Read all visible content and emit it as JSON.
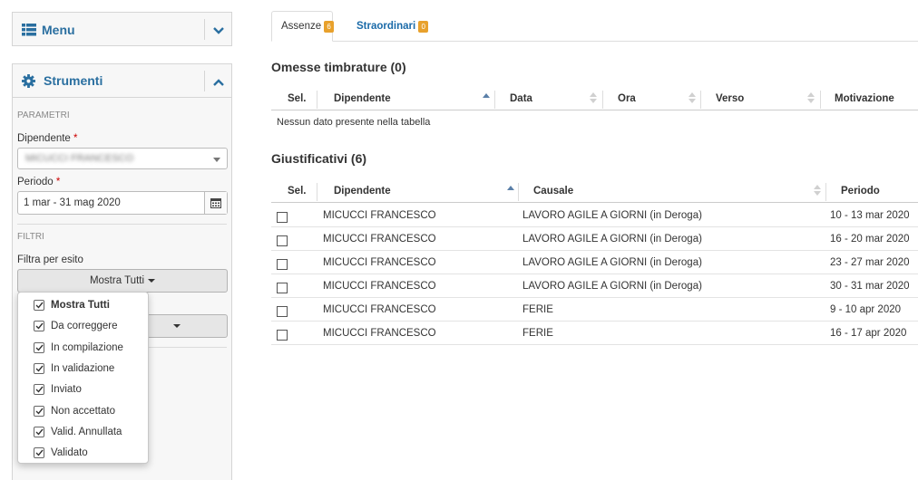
{
  "sidebar": {
    "menu": {
      "title": "Menu"
    },
    "tools": {
      "title": "Strumenti",
      "params_label": "PARAMETRI",
      "employee_label": "Dipendente",
      "employee_value": "MICUCCI FRANCESCO",
      "period_label": "Periodo",
      "period_value": "1 mar - 31 mag 2020",
      "filters_label": "FILTRI",
      "filter_outcome_label": "Filtra per esito",
      "show_all_button": "Mostra Tutti",
      "required_mark": "*"
    },
    "dropdown": {
      "items": [
        {
          "label": "Mostra Tutti",
          "checked": true
        },
        {
          "label": "Da correggere",
          "checked": true
        },
        {
          "label": "In compilazione",
          "checked": true
        },
        {
          "label": "In validazione",
          "checked": true
        },
        {
          "label": "Inviato",
          "checked": true
        },
        {
          "label": "Non accettato",
          "checked": true
        },
        {
          "label": "Valid. Annullata",
          "checked": true
        },
        {
          "label": "Validato",
          "checked": true
        }
      ]
    }
  },
  "tabs": [
    {
      "label": "Assenze",
      "badge": "6",
      "active": true
    },
    {
      "label": "Straordinari",
      "badge": "0",
      "active": false
    }
  ],
  "omissions": {
    "title": "Omesse timbrature (0)",
    "columns": [
      "Sel.",
      "Dipendente",
      "Data",
      "Ora",
      "Verso",
      "Motivazione"
    ],
    "empty_text": "Nessun dato presente nella tabella"
  },
  "justifications": {
    "title": "Giustificativi (6)",
    "columns": [
      "Sel.",
      "Dipendente",
      "Causale",
      "Periodo"
    ],
    "rows": [
      {
        "employee": "MICUCCI FRANCESCO",
        "reason": "LAVORO AGILE A GIORNI (in Deroga)",
        "period": "10 - 13 mar 2020"
      },
      {
        "employee": "MICUCCI FRANCESCO",
        "reason": "LAVORO AGILE A GIORNI (in Deroga)",
        "period": "16 - 20 mar 2020"
      },
      {
        "employee": "MICUCCI FRANCESCO",
        "reason": "LAVORO AGILE A GIORNI (in Deroga)",
        "period": "23 - 27 mar 2020"
      },
      {
        "employee": "MICUCCI FRANCESCO",
        "reason": "LAVORO AGILE A GIORNI (in Deroga)",
        "period": "30 - 31 mar 2020"
      },
      {
        "employee": "MICUCCI FRANCESCO",
        "reason": "FERIE",
        "period": "9 - 10 apr 2020"
      },
      {
        "employee": "MICUCCI FRANCESCO",
        "reason": "FERIE",
        "period": "16 - 17 apr 2020"
      }
    ]
  },
  "colors": {
    "accent": "#2a6fa0",
    "link": "#1a6aa8",
    "badge": "#e8a12c"
  }
}
